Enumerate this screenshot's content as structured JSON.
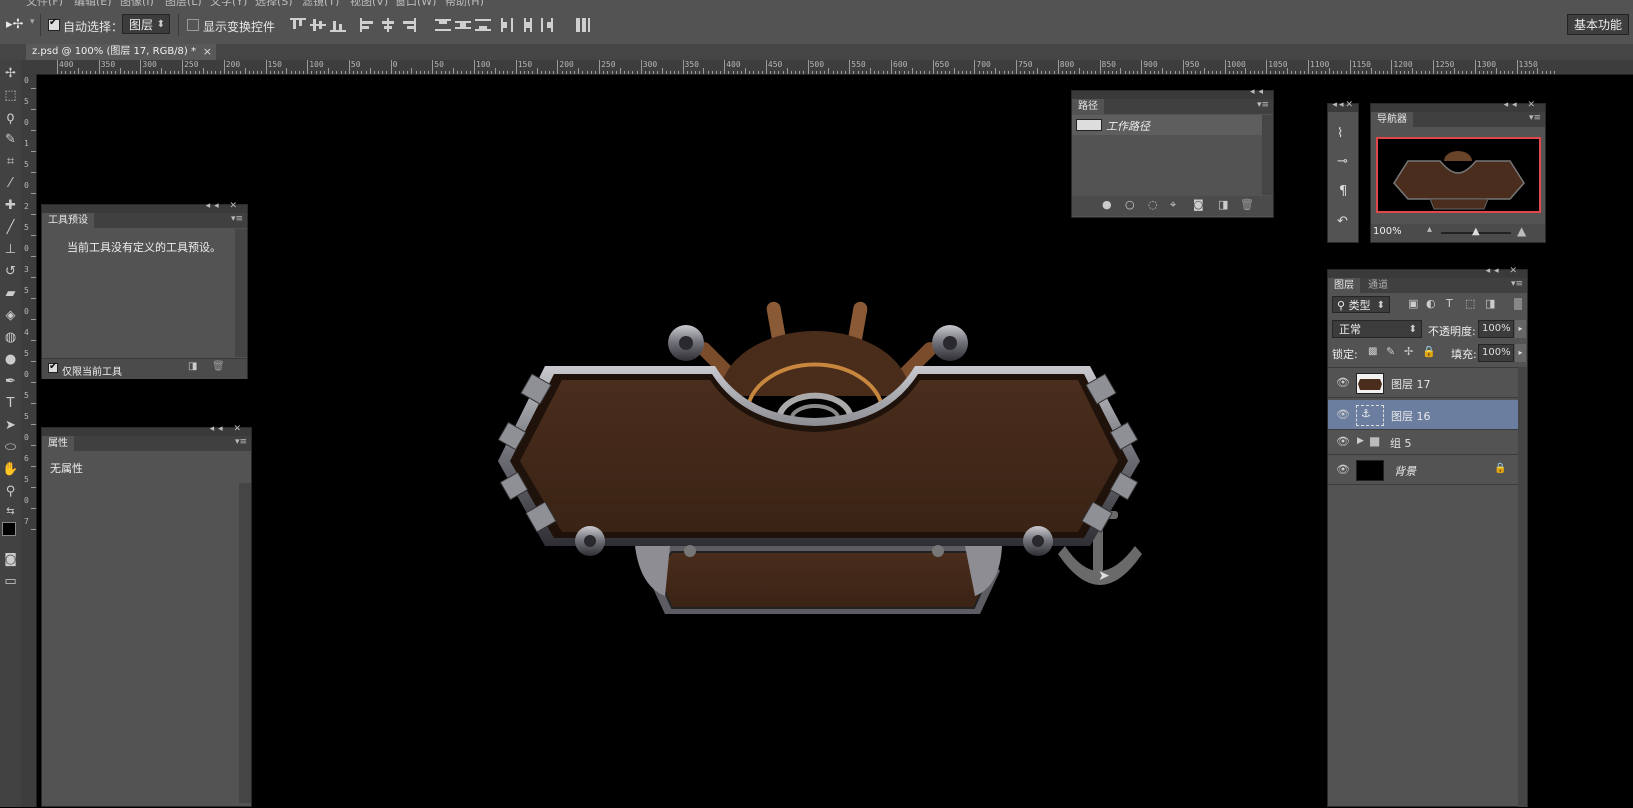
{
  "menu": [
    "文件(F)",
    "编辑(E)",
    "图像(I)",
    "图层(L)",
    "文字(Y)",
    "选择(S)",
    "滤镜(T)",
    "视图(V)",
    "窗口(W)",
    "帮助(H)"
  ],
  "options": {
    "auto_select_label": "自动选择：",
    "auto_select_value": "图层",
    "show_transform_label": "显示变换控件",
    "workspace": "基本功能"
  },
  "document": {
    "tab_title": "z.psd @ 100% (图层 17, RGB/8) *",
    "close": "×"
  },
  "ruler": {
    "h_labels": [
      "400",
      "350",
      "300",
      "250",
      "200",
      "150",
      "100",
      "50",
      "0",
      "50",
      "100",
      "150",
      "200",
      "250",
      "300",
      "350",
      "400",
      "450",
      "500",
      "550",
      "600",
      "650",
      "700",
      "750",
      "800",
      "850",
      "900",
      "950",
      "1000",
      "1050",
      "1100",
      "1150",
      "1200",
      "1250",
      "1300",
      "1350"
    ],
    "v_labels": [
      "0",
      "5",
      "0",
      "1",
      "5",
      "0",
      "2",
      "5",
      "0",
      "3",
      "5",
      "0",
      "4",
      "5",
      "0",
      "5",
      "5",
      "0",
      "6",
      "5",
      "0",
      "7"
    ]
  },
  "tool_presets": {
    "title": "工具预设",
    "message": "当前工具没有定义的工具预设。",
    "current_only": "仅限当前工具"
  },
  "properties": {
    "title": "属性",
    "message": "无属性"
  },
  "paths": {
    "title": "路径",
    "work_path": "工作路径"
  },
  "navigator": {
    "title": "导航器",
    "zoom": "100%"
  },
  "layers": {
    "tab_layers": "图层",
    "tab_channels": "通道",
    "filter_kind": "类型",
    "blend_mode": "正常",
    "opacity_label": "不透明度:",
    "opacity_value": "100%",
    "lock_label": "锁定:",
    "fill_label": "填充:",
    "fill_value": "100%",
    "items": [
      {
        "name": "图层 17",
        "selected": false
      },
      {
        "name": "图层 16",
        "selected": true
      },
      {
        "name": "组 5",
        "selected": false
      },
      {
        "name": "背景",
        "selected": false
      }
    ]
  },
  "colors": {
    "panel": "#535353",
    "selection": "#6c7ea0",
    "navigator_frame": "#e0474a"
  }
}
